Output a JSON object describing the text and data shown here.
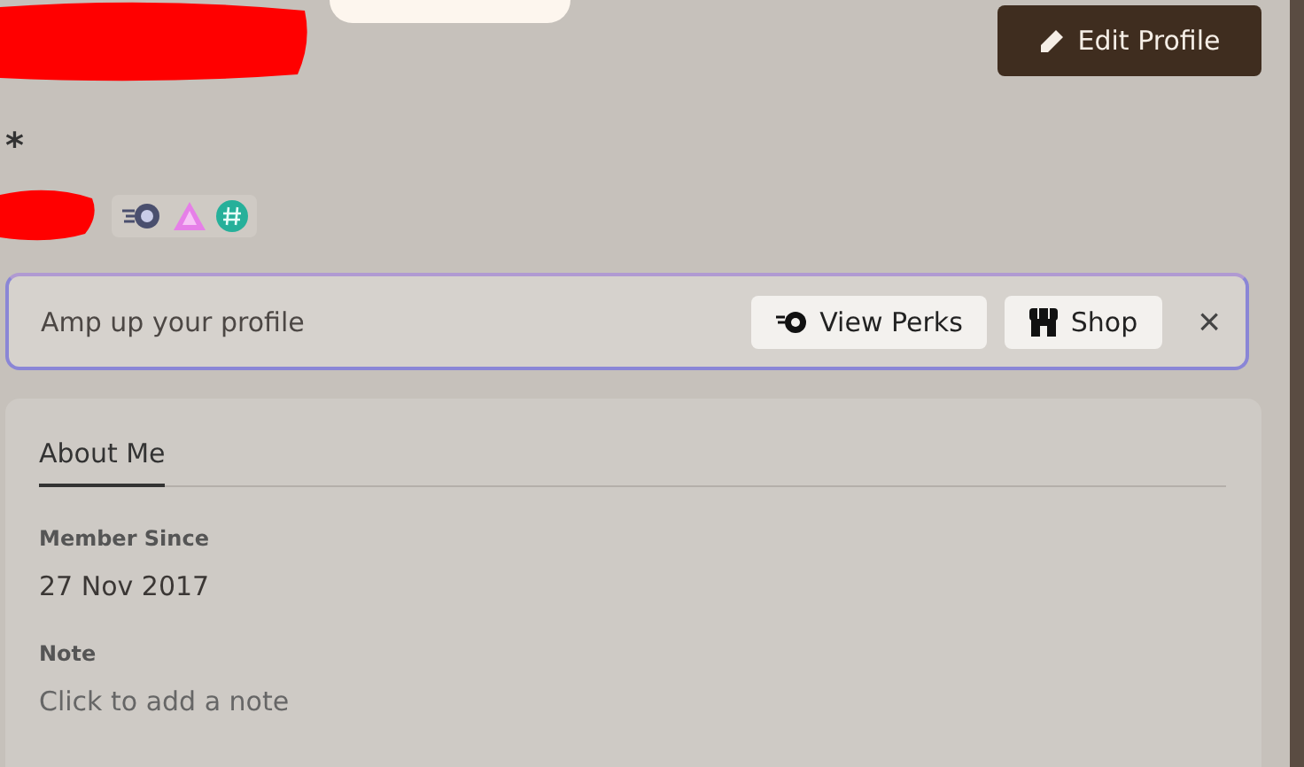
{
  "header": {
    "edit_button": "Edit Profile",
    "pronoun_marker": "*"
  },
  "badges": [
    {
      "kind": "nitro"
    },
    {
      "kind": "boost"
    },
    {
      "kind": "hashtag"
    }
  ],
  "promo": {
    "text": "Amp up your profile",
    "buttons": [
      {
        "kind": "perks",
        "label": "View Perks"
      },
      {
        "kind": "shop",
        "label": "Shop"
      }
    ],
    "close": "×"
  },
  "about": {
    "tab": "About Me",
    "sections": [
      {
        "title": "Member Since",
        "value": "27 Nov 2017",
        "kind": "value"
      },
      {
        "title": "Note",
        "value": "Click to add a note",
        "kind": "placeholder"
      }
    ]
  }
}
